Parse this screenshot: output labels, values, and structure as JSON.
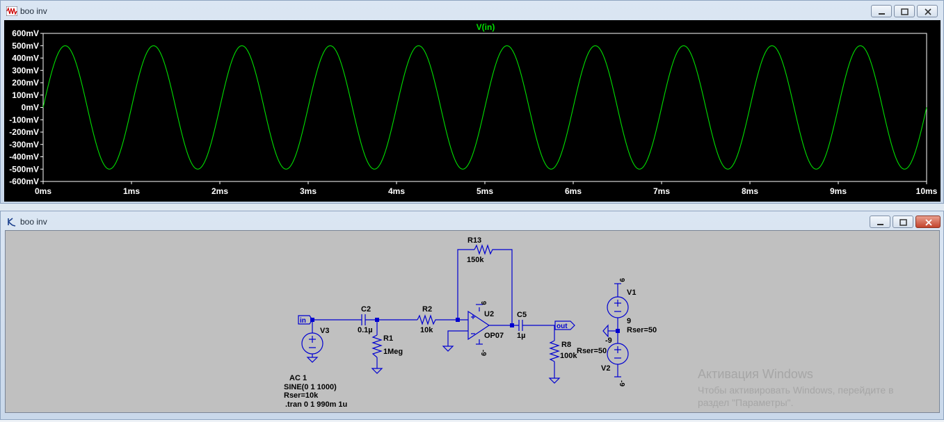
{
  "plot_window": {
    "title": "boo inv",
    "chart_data": {
      "type": "line",
      "title": "V(in)",
      "xlabel": "",
      "ylabel": "",
      "x_ticks": [
        "0ms",
        "1ms",
        "2ms",
        "3ms",
        "4ms",
        "5ms",
        "6ms",
        "7ms",
        "8ms",
        "9ms",
        "10ms"
      ],
      "y_ticks": [
        "600mV",
        "500mV",
        "400mV",
        "300mV",
        "200mV",
        "100mV",
        "0mV",
        "-100mV",
        "-200mV",
        "-300mV",
        "-400mV",
        "-500mV",
        "-600mV"
      ],
      "xlim": [
        0,
        10
      ],
      "ylim": [
        -600,
        600
      ],
      "grid": false,
      "series": [
        {
          "name": "V(in)",
          "color": "#00e000",
          "function": "500*sin(2*pi*1000*t)",
          "amplitude": 500,
          "frequency_hz": 1000,
          "offset": 0
        }
      ]
    }
  },
  "schematic_window": {
    "title": "boo inv",
    "labels": {
      "r13_name": "R13",
      "r13_value": "150k",
      "c2_name": "C2",
      "c2_value": "0.1µ",
      "r2_name": "R2",
      "r2_value": "10k",
      "u2_name": "U2",
      "u2_model": "OP07",
      "c5_name": "C5",
      "c5_value": "1µ",
      "r1_name": "R1",
      "r1_value": "1Meg",
      "r8_name": "R8",
      "r8_value": "100k",
      "v3_name": "V3",
      "v1_name": "V1",
      "v1_rser": "Rser=50",
      "v2_name": "V2",
      "v2_rser": "Rser=50",
      "in_label": "in",
      "out_label": "out",
      "u2_vplus": "9",
      "u2_vminus": "-9",
      "v1_top": "9",
      "v1_bottom": "9",
      "v2_top": "-9",
      "v2_bottom": "-9",
      "v3_line1": "AC 1",
      "v3_line2": "SINE(0 1 1000)",
      "v3_line3": "Rser=10k",
      "directive": ".tran 0 1 990m 1u"
    },
    "watermark": {
      "line1": "Активация Windows",
      "line2": "Чтобы активировать Windows, перейдите в",
      "line3": "раздел \"Параметры\"."
    }
  }
}
